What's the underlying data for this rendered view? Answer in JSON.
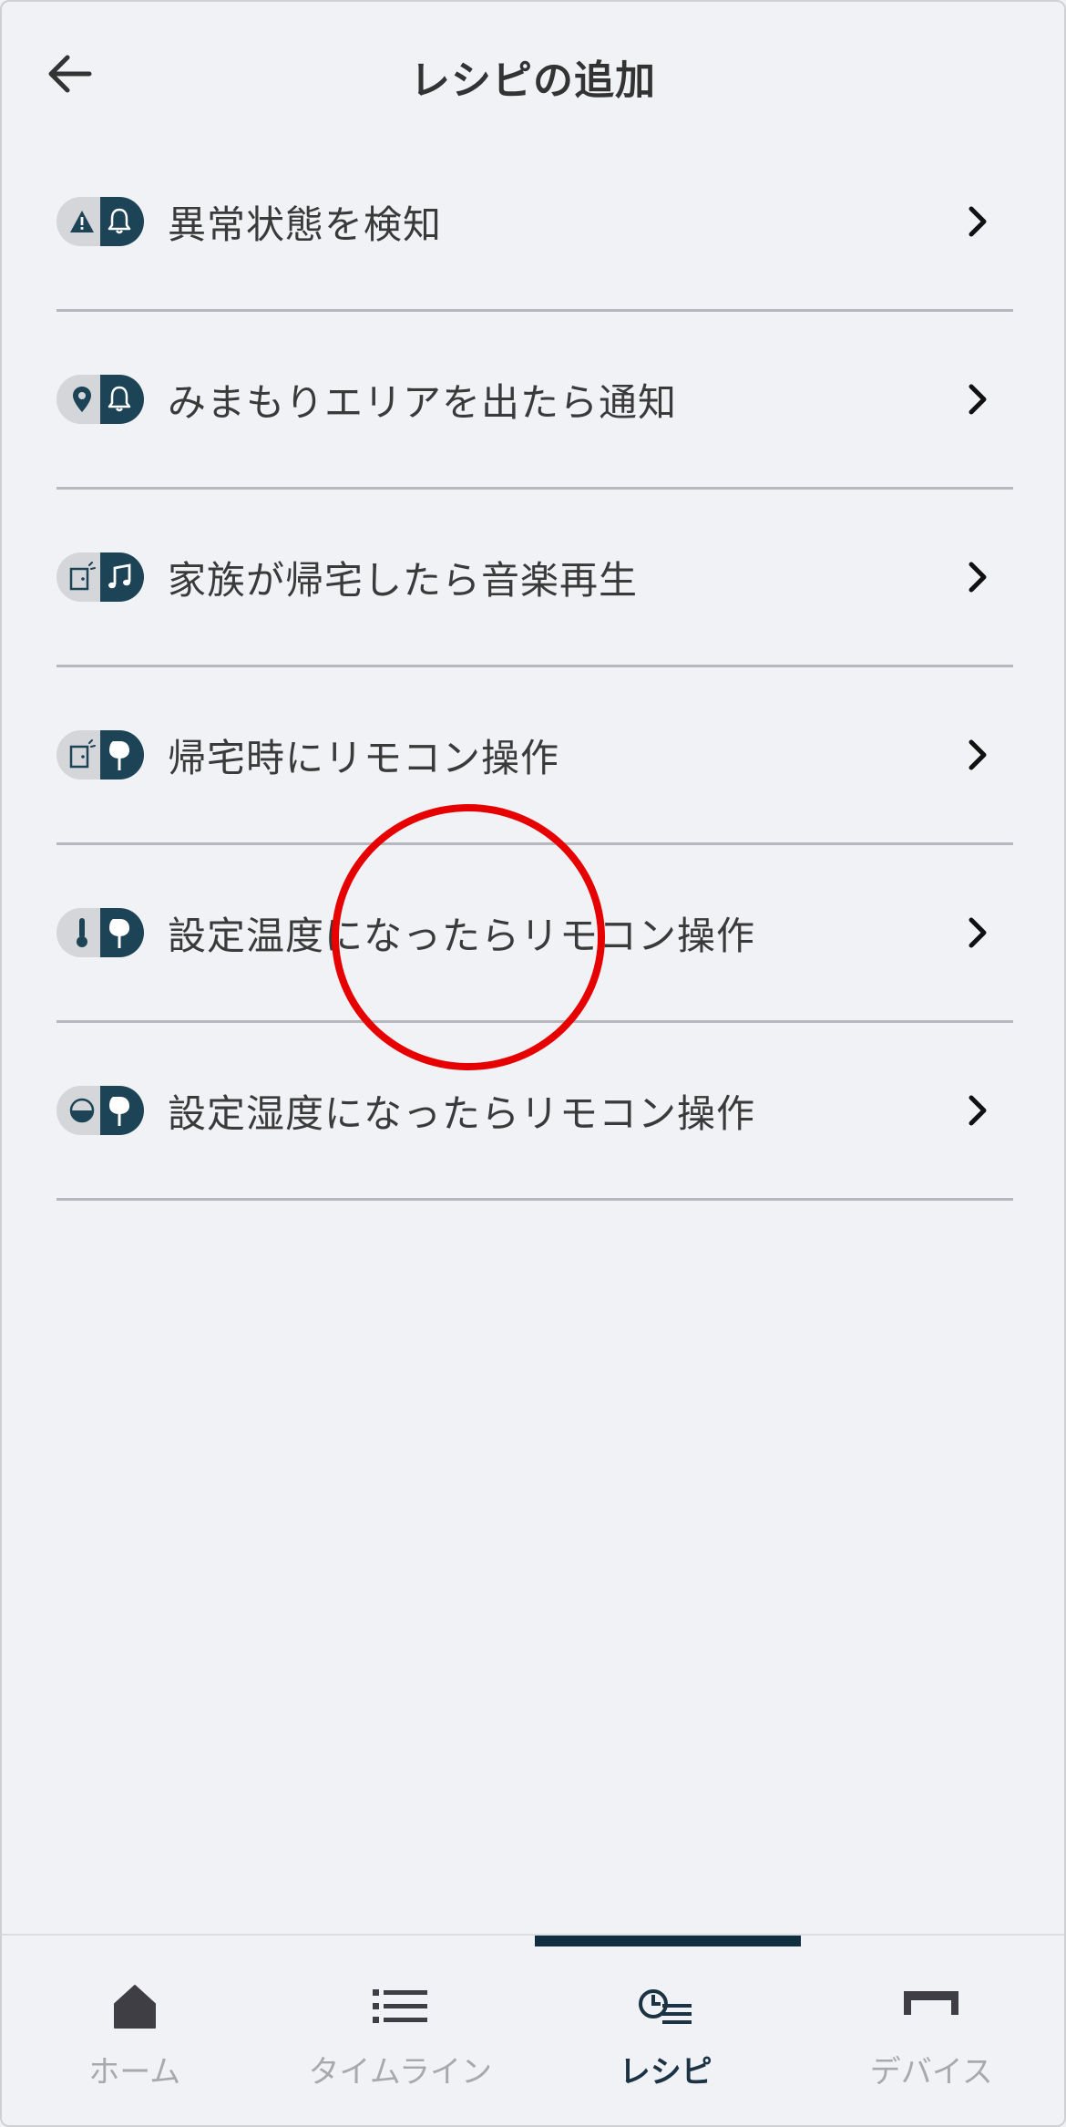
{
  "header": {
    "title": "レシピの追加",
    "back_icon": "arrow-left-icon"
  },
  "recipes": [
    {
      "label": "異常状態を検知",
      "icon_left": "warning-icon",
      "icon_right": "bell-icon"
    },
    {
      "label": "みまもりエリアを出たら通知",
      "icon_left": "location-pin-icon",
      "icon_right": "bell-icon"
    },
    {
      "label": "家族が帰宅したら音楽再生",
      "icon_left": "door-sensor-icon",
      "icon_right": "music-note-icon"
    },
    {
      "label": "帰宅時にリモコン操作",
      "icon_left": "door-sensor-icon",
      "icon_right": "remote-plug-icon"
    },
    {
      "label": "設定温度になったらリモコン操作",
      "icon_left": "thermometer-icon",
      "icon_right": "remote-plug-icon"
    },
    {
      "label": "設定湿度になったらリモコン操作",
      "icon_left": "humidity-drop-icon",
      "icon_right": "remote-plug-icon"
    }
  ],
  "nav": {
    "items": [
      {
        "label": "ホーム",
        "icon": "home-icon"
      },
      {
        "label": "タイムライン",
        "icon": "list-icon"
      },
      {
        "label": "レシピ",
        "icon": "recipe-icon",
        "active": true
      },
      {
        "label": "デバイス",
        "icon": "device-icon"
      }
    ]
  },
  "colors": {
    "accent": "#1d4357",
    "annotation": "#e60000",
    "background": "#f1f2f6"
  }
}
